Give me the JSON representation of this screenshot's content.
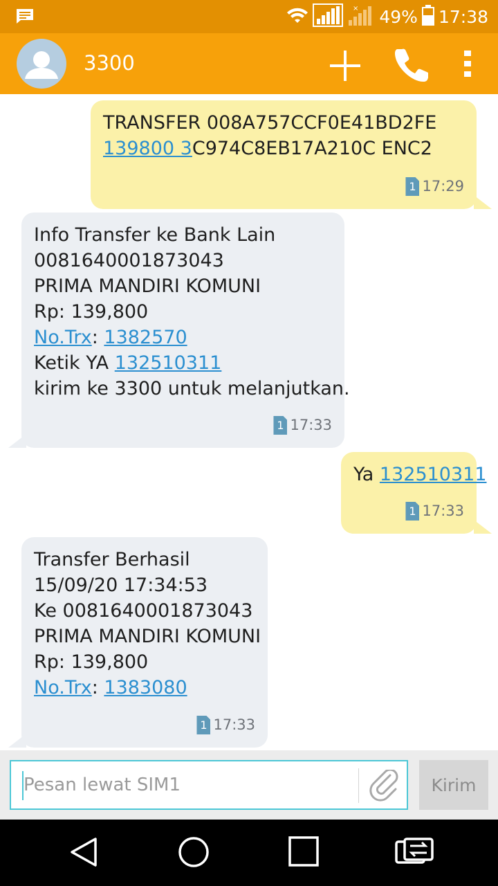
{
  "status_bar": {
    "battery_text": "49%",
    "time": "17:38",
    "icons": [
      "message-notification-icon",
      "wifi-icon",
      "signal-sim1-icon",
      "signal-sim2-icon",
      "battery-icon"
    ]
  },
  "header": {
    "contact_name": "3300",
    "actions": [
      "add-icon",
      "phone-icon",
      "more-vert-icon"
    ]
  },
  "messages": [
    {
      "direction": "outgoing",
      "lines": [
        {
          "text": "TRANSFER 008A757CCF0E41BD2FE"
        },
        {
          "link": "139800 3",
          "rest": "C974C8EB17A210C ENC2"
        }
      ],
      "sim": "1",
      "time": "17:29"
    },
    {
      "direction": "incoming",
      "lines": [
        {
          "text": "Info Transfer ke Bank Lain"
        },
        {
          "text": "0081640001873043"
        },
        {
          "text": "PRIMA MANDIRI KOMUNI"
        },
        {
          "text": "Rp: 139,800"
        },
        {
          "link": "No.Trx",
          "sep": ": ",
          "link2": "1382570"
        },
        {
          "prefix": "Ketik YA ",
          "link": "132510311"
        },
        {
          "text": "kirim ke 3300 untuk melanjutkan."
        }
      ],
      "sim": "1",
      "time": "17:33"
    },
    {
      "direction": "outgoing",
      "lines": [
        {
          "prefix": "Ya ",
          "link": "132510311"
        }
      ],
      "sim": "1",
      "time": "17:33"
    },
    {
      "direction": "incoming",
      "lines": [
        {
          "text": "Transfer Berhasil"
        },
        {
          "text": "15/09/20 17:34:53"
        },
        {
          "text": "Ke 0081640001873043"
        },
        {
          "text": "PRIMA MANDIRI KOMUNI"
        },
        {
          "text": "Rp: 139,800"
        },
        {
          "link": "No.Trx",
          "sep": ": ",
          "link2": "1383080"
        }
      ],
      "sim": "1",
      "time": "17:33"
    }
  ],
  "composer": {
    "placeholder": "Pesan lewat SIM1",
    "send_label": "Kirim"
  },
  "nav_bar": {
    "buttons": [
      "back-icon",
      "home-icon",
      "recents-icon",
      "sim-switch-icon"
    ]
  },
  "colors": {
    "status_bar": "#e39002",
    "app_bar": "#f7a10a",
    "outgoing_bubble": "#fbf1a9",
    "incoming_bubble": "#eceff3",
    "link": "#2b8fd0",
    "input_border": "#4cc7d6"
  }
}
